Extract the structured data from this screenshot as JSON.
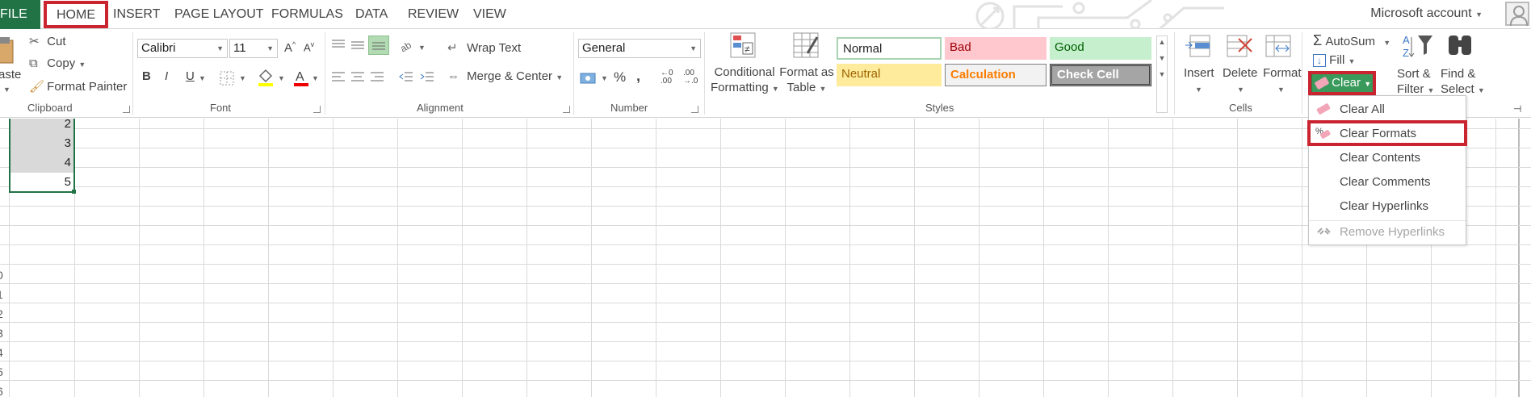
{
  "tabs": {
    "file": "FILE",
    "home": "HOME",
    "insert": "INSERT",
    "page_layout": "PAGE LAYOUT",
    "formulas": "FORMULAS",
    "data": "DATA",
    "review": "REVIEW",
    "view": "VIEW",
    "account": "Microsoft account"
  },
  "clipboard": {
    "paste": "aste",
    "cut": "Cut",
    "copy": "Copy",
    "format_painter": "Format Painter",
    "label": "Clipboard"
  },
  "font": {
    "name": "Calibri",
    "size": "11",
    "bold": "B",
    "italic": "I",
    "underline": "U",
    "label": "Font"
  },
  "alignment": {
    "wrap_text": "Wrap Text",
    "merge_center": "Merge & Center",
    "label": "Alignment"
  },
  "number": {
    "format": "General",
    "percent": "%",
    "comma": ",",
    "label": "Number"
  },
  "styles": {
    "conditional_line1": "Conditional",
    "conditional_line2": "Formatting",
    "format_table_line1": "Format as",
    "format_table_line2": "Table",
    "normal": "Normal",
    "bad": "Bad",
    "good": "Good",
    "neutral": "Neutral",
    "calculation": "Calculation",
    "check_cell": "Check Cell",
    "label": "Styles"
  },
  "cells": {
    "insert": "Insert",
    "delete": "Delete",
    "format": "Format",
    "label": "Cells"
  },
  "editing": {
    "autosum": "AutoSum",
    "fill": "Fill",
    "clear": "Clear",
    "sort_line1": "Sort &",
    "sort_line2": "Filter",
    "find_line1": "Find &",
    "find_line2": "Select"
  },
  "clear_menu": {
    "clear_all": "Clear All",
    "clear_formats": "Clear Formats",
    "clear_contents": "Clear Contents",
    "clear_comments": "Clear Comments",
    "clear_hyperlinks": "Clear Hyperlinks",
    "remove_hyperlinks": "Remove Hyperlinks"
  },
  "sheet": {
    "cells": [
      "2",
      "3",
      "4",
      "5"
    ],
    "row_numbers": [
      "0",
      "1",
      "2",
      "3",
      "4",
      "5",
      "6"
    ]
  },
  "colors": {
    "accent_red": "#c9242f",
    "file_green": "#217346"
  }
}
